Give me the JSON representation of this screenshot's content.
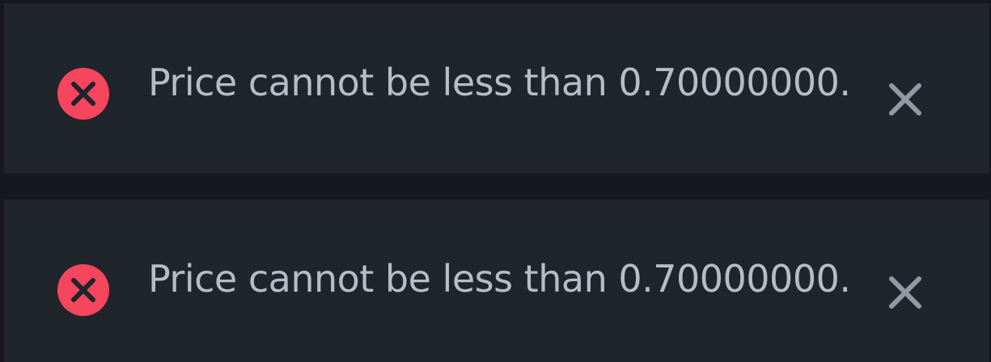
{
  "notifications": [
    {
      "type": "error",
      "icon": "error-x-circle-icon",
      "message": "Price cannot be less than 0.70000000.",
      "close_icon": "close-icon"
    },
    {
      "type": "error",
      "icon": "error-x-circle-icon",
      "message": "Price cannot be less than 0.70000000.",
      "close_icon": "close-icon"
    }
  ],
  "colors": {
    "background": "#16181d",
    "toast_background": "#20242b",
    "error": "#f6465d",
    "text": "#b7bdc6",
    "close": "#9299a4"
  }
}
